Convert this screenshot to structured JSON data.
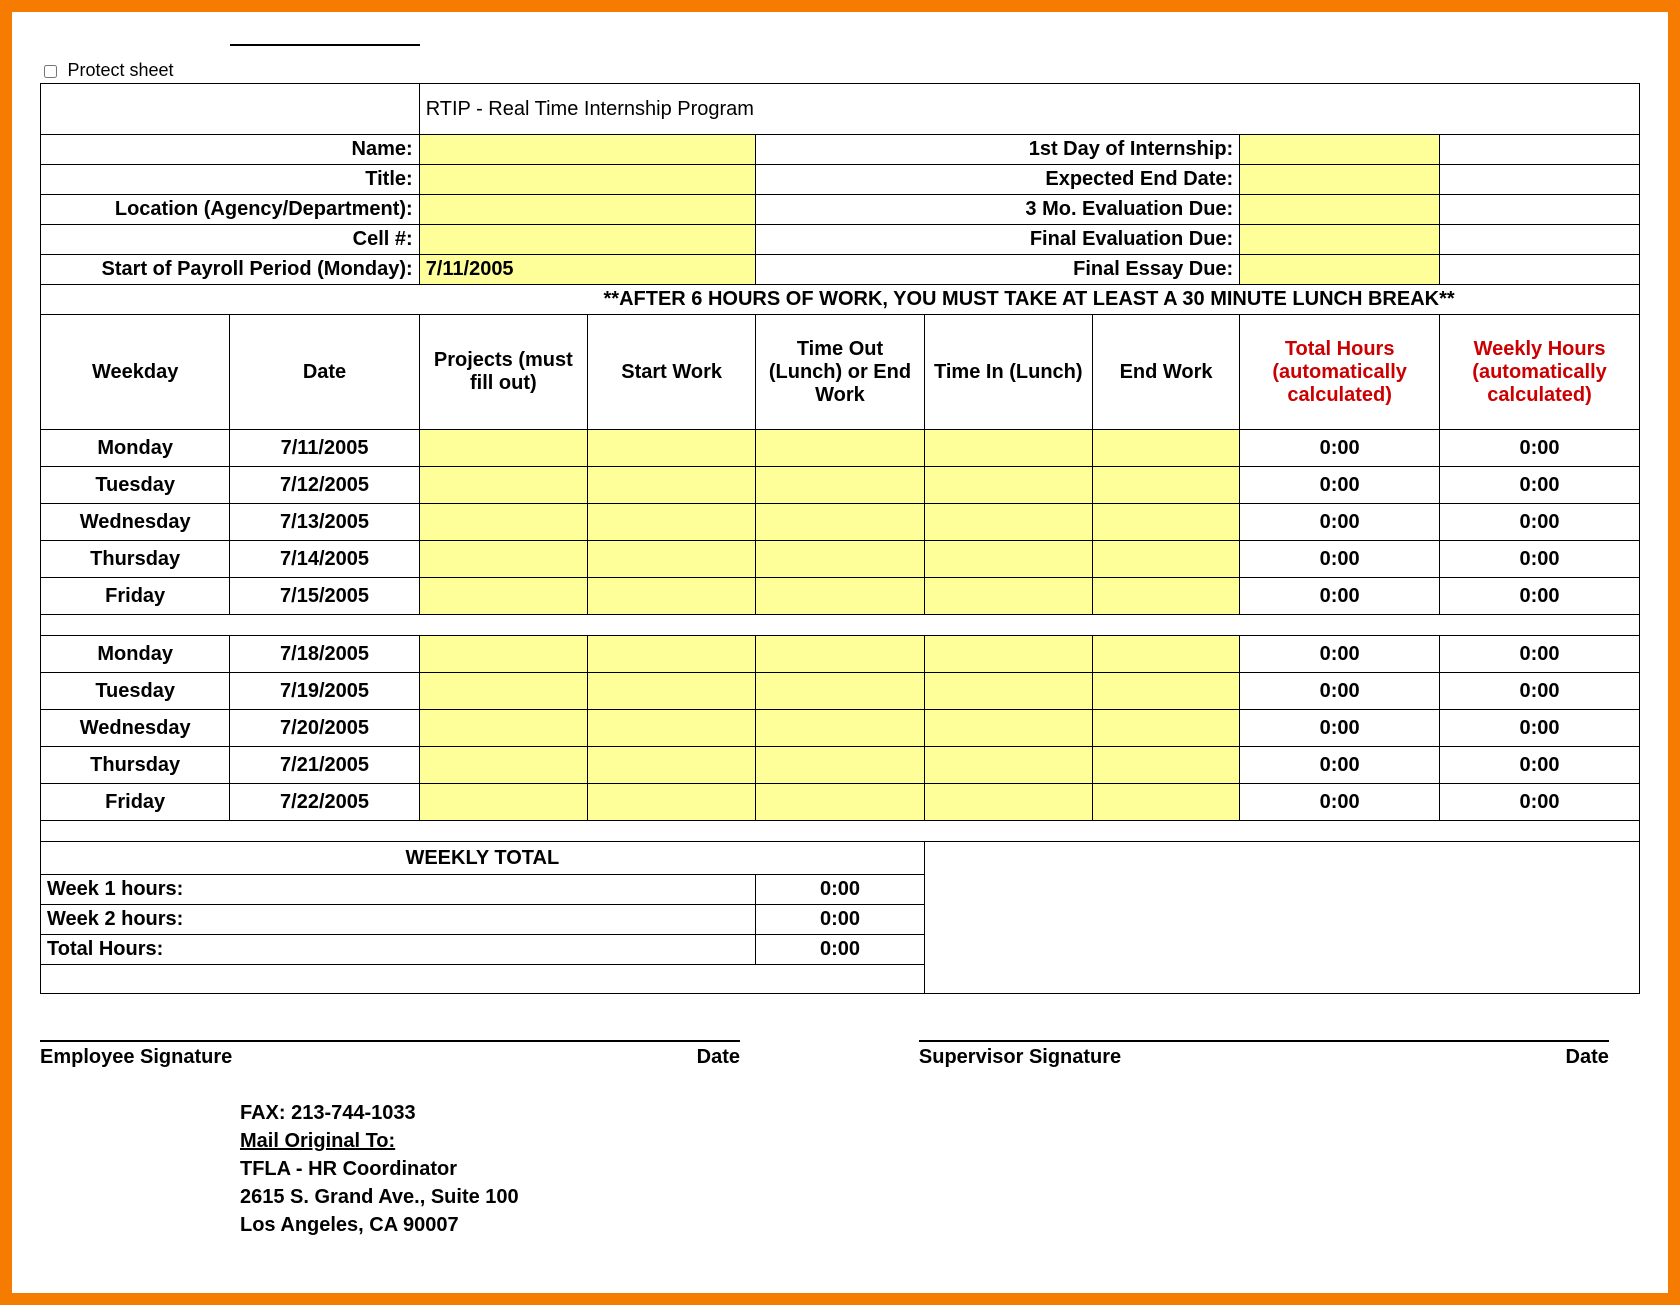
{
  "protect_label": "Protect sheet",
  "title": "RTIP - Real Time Internship Program",
  "fields": {
    "name_label": "Name:",
    "title_label": "Title:",
    "loc_label": "Location (Agency/Department):",
    "cell_label": "Cell #:",
    "payroll_label": "Start of Payroll Period (Monday):",
    "payroll_value": "7/11/2005",
    "firstday_label": "1st Day of Internship:",
    "enddate_label": "Expected End Date:",
    "eval3_label": "3 Mo. Evaluation Due:",
    "evalfinal_label": "Final Evaluation Due:",
    "finalessay_label": "Final Essay Due:"
  },
  "note": "**AFTER 6 HOURS OF WORK, YOU MUST TAKE AT LEAST A 30 MINUTE LUNCH BREAK**",
  "headers": {
    "weekday": "Weekday",
    "date": "Date",
    "projects": "Projects (must fill out)",
    "start": "Start Work",
    "timeout": "Time Out (Lunch) or End Work",
    "timein": "Time In (Lunch)",
    "endwork": "End Work",
    "total_hours": "Total Hours (automatically calculated)",
    "weekly_hours": "Weekly Hours (automatically calculated)"
  },
  "weeks": [
    {
      "rows": [
        {
          "weekday": "Monday",
          "date": "7/11/2005",
          "total": "0:00",
          "weekly": "0:00"
        },
        {
          "weekday": "Tuesday",
          "date": "7/12/2005",
          "total": "0:00",
          "weekly": "0:00"
        },
        {
          "weekday": "Wednesday",
          "date": "7/13/2005",
          "total": "0:00",
          "weekly": "0:00"
        },
        {
          "weekday": "Thursday",
          "date": "7/14/2005",
          "total": "0:00",
          "weekly": "0:00"
        },
        {
          "weekday": "Friday",
          "date": "7/15/2005",
          "total": "0:00",
          "weekly": "0:00"
        }
      ]
    },
    {
      "rows": [
        {
          "weekday": "Monday",
          "date": "7/18/2005",
          "total": "0:00",
          "weekly": "0:00"
        },
        {
          "weekday": "Tuesday",
          "date": "7/19/2005",
          "total": "0:00",
          "weekly": "0:00"
        },
        {
          "weekday": "Wednesday",
          "date": "7/20/2005",
          "total": "0:00",
          "weekly": "0:00"
        },
        {
          "weekday": "Thursday",
          "date": "7/21/2005",
          "total": "0:00",
          "weekly": "0:00"
        },
        {
          "weekday": "Friday",
          "date": "7/22/2005",
          "total": "0:00",
          "weekly": "0:00"
        }
      ]
    }
  ],
  "totals": {
    "title": "WEEKLY TOTAL",
    "week1_label": "Week 1 hours:",
    "week1_val": "0:00",
    "week2_label": "Week 2 hours:",
    "week2_val": "0:00",
    "total_label": "Total Hours:",
    "total_val": "0:00"
  },
  "signatures": {
    "emp": "Employee Signature",
    "date": "Date",
    "sup": "Supervisor Signature"
  },
  "contact": {
    "fax": "FAX:  213-744-1033",
    "mail_heading": "Mail Original To:",
    "l1": "TFLA - HR Coordinator",
    "l2": "2615 S. Grand Ave., Suite 100",
    "l3": "Los Angeles, CA 90007"
  }
}
